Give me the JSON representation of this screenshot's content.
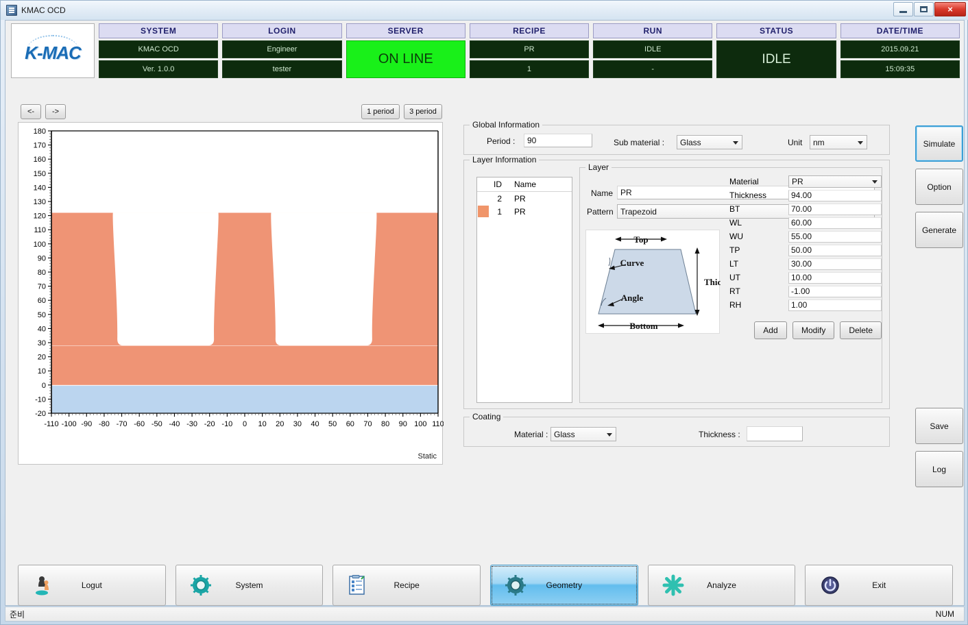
{
  "window": {
    "title": "KMAC OCD",
    "icon": "app-icon",
    "minimize": "minimize-icon",
    "maximize": "maximize-icon",
    "close": "×"
  },
  "logo": {
    "text": "K-MAC"
  },
  "header": {
    "columns": [
      {
        "title": "SYSTEM",
        "line1": "KMAC OCD",
        "line2": "Ver. 1.0.0",
        "style": "dark"
      },
      {
        "title": "LOGIN",
        "line1": "Engineer",
        "line2": "tester",
        "style": "dark"
      },
      {
        "title": "SERVER",
        "single": "ON LINE",
        "style": "online"
      },
      {
        "title": "RECIPE",
        "line1": "PR",
        "line2": "1",
        "style": "dark"
      },
      {
        "title": "RUN",
        "line1": "IDLE",
        "line2": "-",
        "style": "dark"
      },
      {
        "title": "STATUS",
        "single": "IDLE",
        "style": "dark-big"
      },
      {
        "title": "DATE/TIME",
        "line1": "2015.09.21",
        "line2": "15:09:35",
        "style": "dark"
      }
    ]
  },
  "nav": {
    "prev": "<-",
    "next": "->",
    "period_1": "1 period",
    "period_3": "3 period"
  },
  "chart_data": {
    "type": "area",
    "title": "",
    "xlabel": "",
    "ylabel": "",
    "xlim": [
      -110,
      110
    ],
    "ylim": [
      -20,
      180
    ],
    "xticks": [
      -110,
      -100,
      -90,
      -80,
      -70,
      -60,
      -50,
      -40,
      -30,
      -20,
      -10,
      0,
      10,
      20,
      30,
      40,
      50,
      60,
      70,
      80,
      90,
      100,
      110
    ],
    "yticks": [
      -20,
      -10,
      0,
      10,
      20,
      30,
      40,
      50,
      60,
      70,
      80,
      90,
      100,
      110,
      120,
      130,
      140,
      150,
      160,
      170,
      180
    ],
    "grid": false,
    "legend": "none",
    "annotation": "Static",
    "colors": {
      "pr": "#ef9475",
      "substrate": "#bbd5ef",
      "air": "#ffffff"
    },
    "series": [
      {
        "name": "Substrate (Glass)",
        "color": "#bbd5ef",
        "y_from": -20,
        "y_to": 0
      },
      {
        "name": "PR base layer (ID 1)",
        "color": "#ef9475",
        "y_from": 0,
        "y_to": 28
      },
      {
        "name": "PR grating layer (ID 2)",
        "color": "#ef9475",
        "y_from": 28,
        "y_to": 122,
        "period": 90,
        "trench_centers": [
          -45,
          45
        ],
        "trench_top_width": 60,
        "trench_bottom_width": 55
      }
    ]
  },
  "global_information": {
    "legend": "Global Information",
    "period_label": "Period :",
    "period_value": "90",
    "sub_material_label": "Sub material :",
    "sub_material_value": "Glass",
    "unit_label": "Unit",
    "unit_value": "nm"
  },
  "layer_information": {
    "legend": "Layer Information",
    "table": {
      "headers": [
        "ID",
        "Name"
      ],
      "rows": [
        {
          "id": "2",
          "name": "PR",
          "swatch": false
        },
        {
          "id": "1",
          "name": "PR",
          "swatch": true
        }
      ]
    },
    "layer_group": {
      "legend": "Layer",
      "name_label": "Name",
      "name_value": "PR",
      "pattern_label": "Pattern",
      "pattern_value": "Trapezoid"
    },
    "diagram": {
      "top": "Top",
      "bottom": "Bottom",
      "curve": "Curve",
      "angle": "Angle",
      "thickness": "Thickness"
    },
    "fields": [
      {
        "label": "Material",
        "value": "PR",
        "type": "combo"
      },
      {
        "label": "Thickness",
        "value": "94.00",
        "type": "text"
      },
      {
        "label": "BT",
        "value": "70.00",
        "type": "text"
      },
      {
        "label": "WL",
        "value": "60.00",
        "type": "text"
      },
      {
        "label": "WU",
        "value": "55.00",
        "type": "text"
      },
      {
        "label": "TP",
        "value": "50.00",
        "type": "text"
      },
      {
        "label": "LT",
        "value": "30.00",
        "type": "text"
      },
      {
        "label": "UT",
        "value": "10.00",
        "type": "text"
      },
      {
        "label": "RT",
        "value": "-1.00",
        "type": "text"
      },
      {
        "label": "RH",
        "value": "1.00",
        "type": "text"
      }
    ],
    "buttons": {
      "add": "Add",
      "modify": "Modify",
      "delete": "Delete"
    }
  },
  "coating": {
    "legend": "Coating",
    "material_label": "Material :",
    "material_value": "Glass",
    "thickness_label": "Thickness :",
    "thickness_value": ""
  },
  "side_buttons": {
    "simulate": "Simulate",
    "option": "Option",
    "generate": "Generate",
    "save": "Save",
    "log": "Log"
  },
  "bottom_nav": [
    {
      "label": "Logut",
      "icon": "user-logout-icon",
      "active": false
    },
    {
      "label": "System",
      "icon": "gear-icon",
      "active": false
    },
    {
      "label": "Recipe",
      "icon": "clipboard-icon",
      "active": false
    },
    {
      "label": "Geometry",
      "icon": "gear-icon",
      "active": true
    },
    {
      "label": "Analyze",
      "icon": "asterisk-icon",
      "active": false
    },
    {
      "label": "Exit",
      "icon": "power-icon",
      "active": false
    }
  ],
  "statusbar": {
    "left": "준비",
    "right": "NUM"
  }
}
